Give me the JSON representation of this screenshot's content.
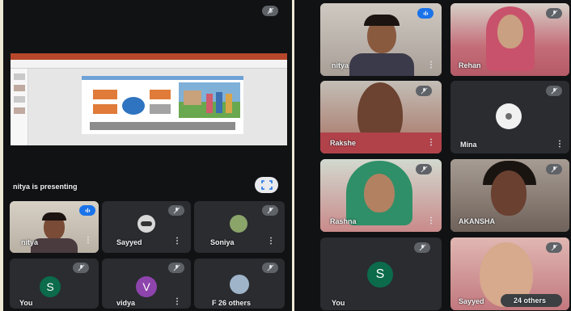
{
  "left": {
    "presentation_caption": "nitya is presenting",
    "participants": [
      {
        "name": "nitya",
        "mic": "on"
      },
      {
        "name": "Sayyed",
        "mic": "muted"
      },
      {
        "name": "Soniya",
        "mic": "muted"
      },
      {
        "name": "You",
        "initial": "S",
        "mic": "muted"
      },
      {
        "name": "vidya",
        "initial": "V",
        "mic": "muted"
      },
      {
        "name": "F  26 others",
        "mic": "muted"
      }
    ]
  },
  "right": {
    "participants": [
      {
        "name": "nitya",
        "mic": "on"
      },
      {
        "name": "Rehan",
        "mic": "muted"
      },
      {
        "name": "Rakshe",
        "mic": "muted"
      },
      {
        "name": "Mina",
        "mic": "muted"
      },
      {
        "name": "Rashna",
        "mic": "muted"
      },
      {
        "name": "AKANSHA",
        "mic": "muted"
      },
      {
        "name": "You",
        "initial": "S",
        "mic": "muted"
      },
      {
        "name": "Sayyed",
        "mic": "muted"
      },
      {
        "name": "24 others",
        "mic": "muted"
      }
    ]
  },
  "colors": {
    "background": "#111214",
    "tile": "#3c4043",
    "mic_active": "#1a73e8",
    "avatar_you": "#0b6b4b",
    "avatar_vidya": "#8e44ad"
  }
}
